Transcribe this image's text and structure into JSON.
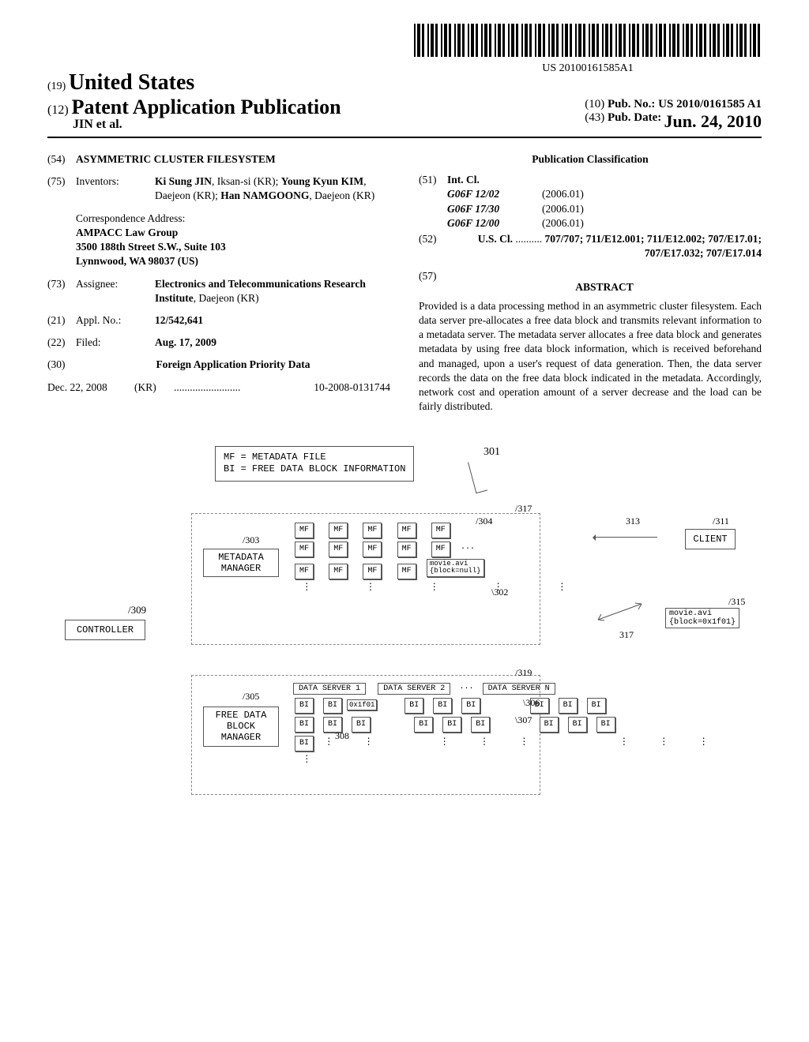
{
  "barcode_text": "US 20100161585A1",
  "header": {
    "code19": "(19)",
    "country": "United States",
    "code12": "(12)",
    "doctype": "Patent Application Publication",
    "authors": "JIN et al.",
    "code10": "(10)",
    "pubno_label": "Pub. No.:",
    "pubno": "US 2010/0161585 A1",
    "code43": "(43)",
    "pubdate_label": "Pub. Date:",
    "pubdate": "Jun. 24, 2010"
  },
  "left": {
    "f54": {
      "code": "(54)",
      "value": "ASYMMETRIC CLUSTER FILESYSTEM"
    },
    "f75": {
      "code": "(75)",
      "label": "Inventors:",
      "value": "Ki Sung JIN, Iksan-si (KR); Young Kyun KIM, Daejeon (KR); Han NAMGOONG, Daejeon (KR)"
    },
    "corr": {
      "label": "Correspondence Address:",
      "line1": "AMPACC Law Group",
      "line2": "3500 188th Street S.W., Suite 103",
      "line3": "Lynnwood, WA 98037 (US)"
    },
    "f73": {
      "code": "(73)",
      "label": "Assignee:",
      "value": "Electronics and Telecommunications Research Institute, Daejeon (KR)"
    },
    "f21": {
      "code": "(21)",
      "label": "Appl. No.:",
      "value": "12/542,641"
    },
    "f22": {
      "code": "(22)",
      "label": "Filed:",
      "value": "Aug. 17, 2009"
    },
    "f30": {
      "code": "(30)",
      "label": "Foreign Application Priority Data"
    },
    "priority": {
      "date": "Dec. 22, 2008",
      "country": "(KR)",
      "dots": ".........................",
      "num": "10-2008-0131744"
    }
  },
  "right": {
    "pub_classif": "Publication Classification",
    "f51": {
      "code": "(51)",
      "label": "Int. Cl.",
      "rows": [
        {
          "sym": "G06F 12/02",
          "ver": "(2006.01)"
        },
        {
          "sym": "G06F 17/30",
          "ver": "(2006.01)"
        },
        {
          "sym": "G06F 12/00",
          "ver": "(2006.01)"
        }
      ]
    },
    "f52": {
      "code": "(52)",
      "label": "U.S. Cl.",
      "dots": "..........",
      "value": "707/707; 711/E12.001; 711/E12.002; 707/E17.01; 707/E17.032; 707/E17.014"
    },
    "f57": {
      "code": "(57)",
      "label": "ABSTRACT"
    },
    "abstract": "Provided is a data processing method in an asymmetric cluster filesystem. Each data server pre-allocates a free data block and transmits relevant information to a metadata server. The metadata server allocates a free data block and generates metadata by using free data block information, which is received beforehand and managed, upon a user's request of data generation. Then, the data server records the data on the free data block indicated in the metadata. Accordingly, network cost and operation amount of a server decrease and the load can be fairly distributed."
  },
  "diagram": {
    "legend1": "MF = METADATA FILE",
    "legend2": "BI = FREE DATA BLOCK INFORMATION",
    "ref301": "301",
    "controller": "CONTROLLER",
    "ref309": "309",
    "meta_mgr": "METADATA MANAGER",
    "ref303": "303",
    "fdb_mgr": "FREE DATA BLOCK MANAGER",
    "ref305": "305",
    "mf": "MF",
    "bi": "BI",
    "ref302": "302",
    "ref304": "304",
    "ref317": "317",
    "ref319": "319",
    "movie_null": "movie.avi\n{block=null}",
    "ds1": "DATA SERVER 1",
    "ds2": "DATA SERVER 2",
    "dsn": "DATA SERVER N",
    "hex": "0x1f01",
    "ref306": "306",
    "ref307": "307",
    "ref308": "308",
    "client": "CLIENT",
    "ref311": "311",
    "ref313": "313",
    "movie_block": "movie.avi\n{block=0x1f01}",
    "ref315": "315"
  }
}
